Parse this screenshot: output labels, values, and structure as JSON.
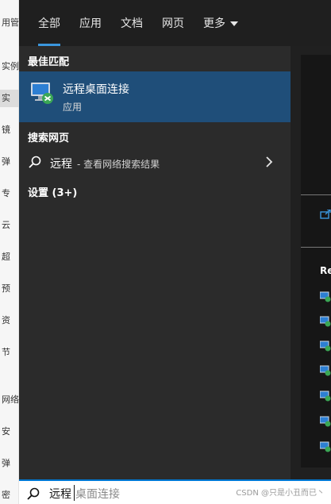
{
  "background_app": {
    "items": [
      "用管",
      "实例与",
      "实",
      "镜",
      "弹",
      "专",
      "云",
      "超",
      "预",
      "资",
      "节",
      "网络与",
      "安",
      "弹",
      "密"
    ]
  },
  "tabs": [
    {
      "label": "全部",
      "active": true
    },
    {
      "label": "应用",
      "active": false
    },
    {
      "label": "文档",
      "active": false
    },
    {
      "label": "网页",
      "active": false
    },
    {
      "label": "更多",
      "active": false
    }
  ],
  "sections": {
    "best_match": "最佳匹配",
    "web_search": "搜索网页",
    "settings": "设置 (3+)"
  },
  "best_match": {
    "title": "远程桌面连接",
    "subtitle": "应用",
    "icon": "remote-desktop-icon"
  },
  "web_result": {
    "term": "远程",
    "hint": "- 查看网络搜索结果"
  },
  "right_pane": {
    "recent_label": "Re",
    "recent_count": 7
  },
  "search": {
    "typed": "远程",
    "suggestion": "桌面连接"
  },
  "watermark": "CSDN @只是小丑而已丶",
  "colors": {
    "accent": "#3a96dd",
    "selected_row": "#1f4e79",
    "panel": "#2b2b2b",
    "tabbar": "#1f1f1f"
  }
}
